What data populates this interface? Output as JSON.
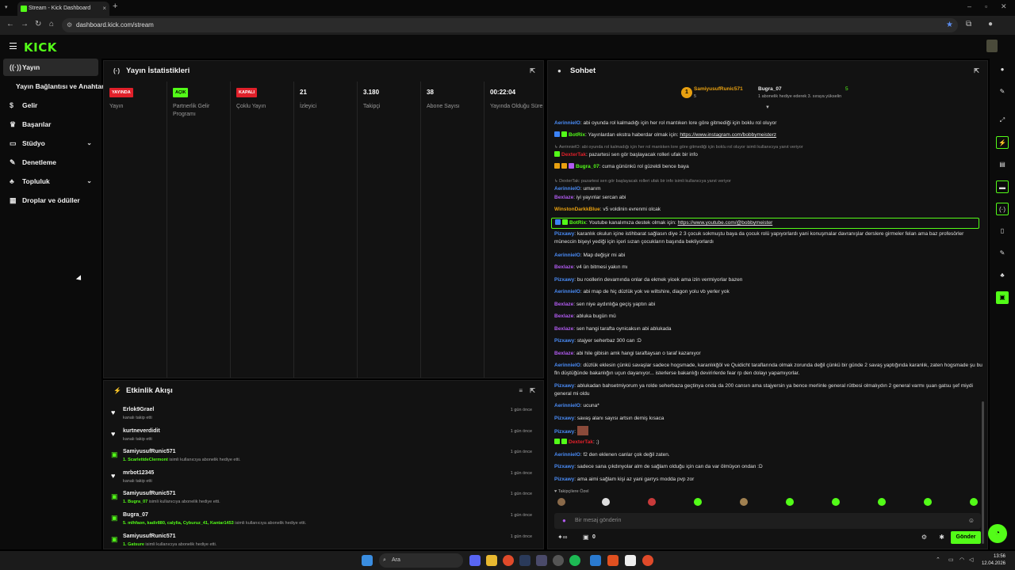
{
  "browser": {
    "tab_title": "Stream - Kick Dashboard",
    "tab_close": "×",
    "new_tab": "+",
    "url": "dashboard.kick.com/stream"
  },
  "app": {
    "logo": "KICK"
  },
  "sidebar": {
    "items": [
      {
        "label": "Yayın",
        "icon": "radio-icon"
      },
      {
        "label": "Yayın Bağlantısı ve Anahtarı"
      },
      {
        "label": "Gelir",
        "icon": "coin-icon"
      },
      {
        "label": "Başarılar",
        "icon": "trophy-icon"
      },
      {
        "label": "Stüdyo",
        "icon": "studio-icon"
      },
      {
        "label": "Denetleme",
        "icon": "wrench-icon"
      },
      {
        "label": "Topluluk",
        "icon": "community-icon"
      },
      {
        "label": "Droplar ve ödüller",
        "icon": "drops-icon"
      }
    ]
  },
  "stats": {
    "title": "Yayın İstatistikleri",
    "columns": [
      {
        "badge": "YAYINDA",
        "label": "Yayın",
        "badge_color": "#e0202a"
      },
      {
        "badge": "AÇIK",
        "label": "Partnerlik Gelir Programı",
        "badge_color": "#53fc18"
      },
      {
        "badge": "KAPALI",
        "label": "Çoklu Yayın",
        "badge_color": "#e0202a"
      },
      {
        "value": "21",
        "label": "İzleyici"
      },
      {
        "value": "3.180",
        "label": "Takipçi"
      },
      {
        "value": "38",
        "label": "Abone Sayısı"
      },
      {
        "value": "00:22:04",
        "label": "Yayında Olduğu Süre"
      }
    ]
  },
  "activity": {
    "title": "Etkinlik Akışı",
    "items": [
      {
        "name": "Erlok9Grael",
        "desc": "kanalı takip etti",
        "time": "1 gün önce",
        "icon": "heart-icon"
      },
      {
        "name": "kurtneverdidit",
        "desc": "kanalı takip etti",
        "time": "1 gün önce",
        "icon": "heart-icon"
      },
      {
        "name": "SamiyusufRunic571",
        "hl": "1. ScarlettdeClermont",
        "desc": " isimli kullanıcıya abonelik hediye etti.",
        "time": "1 gün önce",
        "icon": "gift-icon"
      },
      {
        "name": "mrbot12345",
        "desc": "kanalı takip etti",
        "time": "1 gün önce",
        "icon": "heart-icon"
      },
      {
        "name": "SamiyusufRunic571",
        "hl": "1. Bugra_07",
        "desc": " isimli kullanıcıya abonelik hediye etti.",
        "time": "1 gün önce",
        "icon": "gift-icon"
      },
      {
        "name": "Bugra_07",
        "hl": "5. mlhfaon, kadir880, calylia, Cyburuz_41, Kantar1453",
        "desc": " isimli kullanıcıya abonelik hediye etti.",
        "time": "1 gün önce",
        "icon": "gift-icon"
      },
      {
        "name": "SamiyusufRunic571",
        "hl": "1. Gatsure",
        "desc": " isimli kullanıcıya abonelik hediye etti.",
        "time": "1 gün önce",
        "icon": "gift-icon"
      }
    ]
  },
  "chat": {
    "title": "Sohbet",
    "pinned": {
      "rank": "1",
      "user1": "SamiyusufRunic571",
      "count1": "5",
      "user2": "Bugra_07",
      "note": "1 abonelik hediye ederek 3. sıraya yükselin",
      "count2": "5"
    },
    "messages": [
      {
        "user": "AerinnielO",
        "color": "#4a8cf7",
        "text": ": abi oyunda rol kalmadığı için her rol mantıken lore göre gitmediği için boklu rol oluyor"
      },
      {
        "user": "BotRix",
        "color": "#53fc18",
        "text": ": Yayınlardan ekstra haberdar olmak için: ",
        "link": "https://www.instagram.com/bobbymeisterz",
        "badges": [
          "#3b82f6",
          "#53fc18"
        ]
      },
      {
        "reply": "↳ AerinnielO: abi oyunda rol kalmadığı için her rol mantıken lore göre gitmediği için boklu rol oluyor isimli kullanıcıya yanıt veriyor",
        "user": "DexterTak",
        "color": "#e0202a",
        "text": ": pazartesi sen gör başlayacak rolleri ufak bir info",
        "badges": [
          "#53fc18"
        ]
      },
      {
        "user": "Bugra_07",
        "color": "#53fc18",
        "text": ": cuma gününkü rol güzeldi bence baya",
        "badges": [
          "#e8a010",
          "#e8a010",
          "#b15bf0"
        ]
      },
      {
        "reply": "↳ DexterTak: pazartesi sen gör başlayacak rolleri ufak bir info isimli kullanıcıya yanıt veriyor",
        "user": "AerinnielO",
        "color": "#4a8cf7",
        "text": ": umarım"
      },
      {
        "user": "Bexlaze",
        "color": "#b15bf0",
        "text": ": iyi yayınlar sercan abi"
      },
      {
        "user": "WinstonDarkkBlue",
        "color": "#e8a010",
        "text": ": v5 voldinin evrenmi olcak"
      },
      {
        "user": "BotRix",
        "color": "#53fc18",
        "text": ": Youtube kanalımıza destek olmak için: ",
        "link": "https://www.youtube.com/@bobbymeister",
        "badges": [
          "#3b82f6",
          "#53fc18"
        ],
        "highlight": true
      },
      {
        "user": "Pizxawy",
        "color": "#4a8cf7",
        "text": ": karanlık okulun içine istihbarat sağlasın diye 2 3 çocuk sokmuştu baya da çocuk rolü yapıyorlardı yani konuşmalar davranışlar derslere girmeler felan ama baz profesörler müneccin bişeyi yediği için içeri sızan çocukların başında bekliyorlardı"
      },
      {
        "user": "AerinnielO",
        "color": "#4a8cf7",
        "text": ": Map değişir mi abi"
      },
      {
        "user": "Bexlaze",
        "color": "#b15bf0",
        "text": ": v4 ün bitmesi yakın mı"
      },
      {
        "user": "Pizxawy",
        "color": "#4a8cf7",
        "text": ": bu roollerin devamında onlar da ekmek yicek ama izin vermiyorlar bazen"
      },
      {
        "user": "AerinnielO",
        "color": "#4a8cf7",
        "text": ": abi map de hiç düzlük yok ve wiltshire, diagon yolu vb yerler yok"
      },
      {
        "user": "Bexlaze",
        "color": "#b15bf0",
        "text": ": sen niye aydınlığa geçiş yaptın abi"
      },
      {
        "user": "Bexlaze",
        "color": "#b15bf0",
        "text": ": abluka bugün mü"
      },
      {
        "user": "Bexlaze",
        "color": "#b15bf0",
        "text": ": sen hangi tarafta oynicaksın abi ablukada"
      },
      {
        "user": "Pizxawy",
        "color": "#4a8cf7",
        "text": ": stajyer seherbaz 300 can :D"
      },
      {
        "user": "Bexlaze",
        "color": "#b15bf0",
        "text": ": abi hile gibisin amk hangi taraftaysan o taraf kazanıyor"
      },
      {
        "user": "AerinnielO",
        "color": "#4a8cf7",
        "text": ": düzlük eklesin çünkü savaşlar sadece hogsmade, karanlıkğöl ve Quidicht taraflarında olmak zorunda değil çünkü bir günde 2 savaş yaptığında karanlık, zaten hogsmade şu bu fln düştüğünde bakanlığın uçun dayanıyor... isterlerse bakanlığı devirirlerde fear rp den dolayı yapamıyorlar."
      },
      {
        "user": "Pizxawy",
        "color": "#4a8cf7",
        "text": ": ablukadan bahsetmiyorum ya rolde seherbaza geçtinya onda da 200 cansın ama stajyersin ya bence merlinle general rütbesi olmalıydın 2 general varmı şuan gatsu şef miydi general mi oldu"
      },
      {
        "user": "AerinnielO",
        "color": "#4a8cf7",
        "text": ": ucuna*"
      },
      {
        "user": "Pizxawy",
        "color": "#4a8cf7",
        "text": ": savaş alanı sayısı artsın demiş kısaca"
      },
      {
        "user": "Pizxawy",
        "color": "#4a8cf7",
        "text": ": ",
        "emote": true
      },
      {
        "user": "DexterTak",
        "color": "#e0202a",
        "text": ": ;)",
        "badges": [
          "#53fc18",
          "#53fc18"
        ]
      },
      {
        "user": "AerinnielO",
        "color": "#4a8cf7",
        "text": ": f2 den eklenen canlar çok değil zaten."
      },
      {
        "user": "Pizxawy",
        "color": "#4a8cf7",
        "text": ": sadece sana çıkdınyolar alm de sağlam olduğu için can da var ölmüyon ondan :D"
      },
      {
        "user": "Pizxawy",
        "color": "#4a8cf7",
        "text": ": ama aimi sağlam kişi az yani garrys modda pvp zor"
      }
    ],
    "emotes_label": "♥ Takipçilere Özel",
    "input_placeholder": "Bir mesaj gönderin",
    "footer_count": "0",
    "send_label": "Gönder"
  },
  "taskbar": {
    "search_label": "Ara",
    "time": "13:56",
    "date": "12.04.2026"
  }
}
